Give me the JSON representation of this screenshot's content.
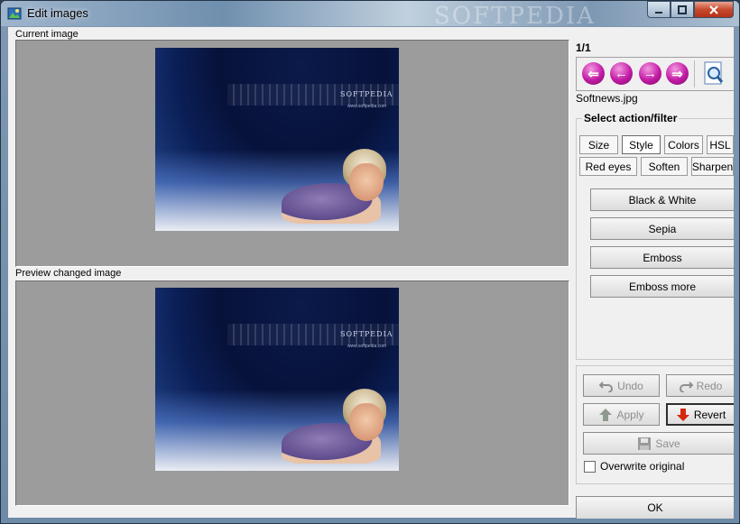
{
  "window": {
    "title": "Edit images",
    "watermark": "SOFTPEDIA"
  },
  "left": {
    "current_label": "Current image",
    "preview_label": "Preview changed image",
    "photo_logo": "SOFTPEDIA",
    "photo_url": "www.softpedia.com"
  },
  "nav": {
    "counter": "1/1",
    "filename": "Softnews.jpg"
  },
  "filters": {
    "group_title": "Select action/filter",
    "tabs_row1": [
      "Size",
      "Style",
      "Colors",
      "HSL"
    ],
    "tabs_row2": [
      "Red eyes",
      "Soften",
      "Sharpen"
    ],
    "active_tab": "Style",
    "style_buttons": [
      "Black & White",
      "Sepia",
      "Emboss",
      "Emboss more"
    ]
  },
  "actions": {
    "undo": "Undo",
    "redo": "Redo",
    "apply": "Apply",
    "revert": "Revert",
    "save": "Save",
    "overwrite_label": "Overwrite original",
    "overwrite_checked": false,
    "ok": "OK"
  },
  "colors": {
    "nav_arrow": "#c21aa5",
    "panel_bg": "#9c9c9c",
    "photo_bg": "#0a1e55"
  }
}
